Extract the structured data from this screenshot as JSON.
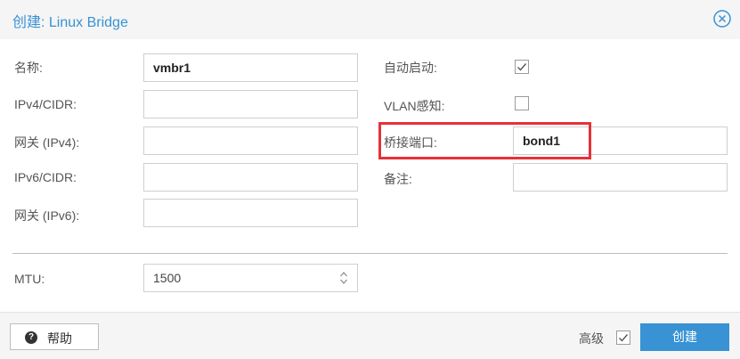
{
  "dialog": {
    "title": "创建: Linux Bridge",
    "close_icon": "circle-x-icon"
  },
  "left_column": {
    "name": {
      "label": "名称:",
      "value": "vmbr1"
    },
    "ipv4_cidr": {
      "label": "IPv4/CIDR:",
      "value": ""
    },
    "gateway_ipv4": {
      "label": "网关 (IPv4):",
      "value": ""
    },
    "ipv6_cidr": {
      "label": "IPv6/CIDR:",
      "value": ""
    },
    "gateway_ipv6": {
      "label": "网关 (IPv6):",
      "value": ""
    }
  },
  "right_column": {
    "autostart": {
      "label": "自动启动:",
      "checked": true
    },
    "vlan_aware": {
      "label": "VLAN感知:",
      "checked": false
    },
    "bridge_ports": {
      "label": "桥接端口:",
      "value": "bond1"
    },
    "comment": {
      "label": "备注:",
      "value": ""
    }
  },
  "mtu": {
    "label": "MTU:",
    "value": "1500"
  },
  "footer": {
    "help_label": "帮助",
    "help_icon": "question-circle-icon",
    "advanced_label": "高级",
    "advanced_checked": true,
    "create_label": "创建"
  },
  "colors": {
    "accent": "#3892d4",
    "highlight": "#e53238"
  }
}
